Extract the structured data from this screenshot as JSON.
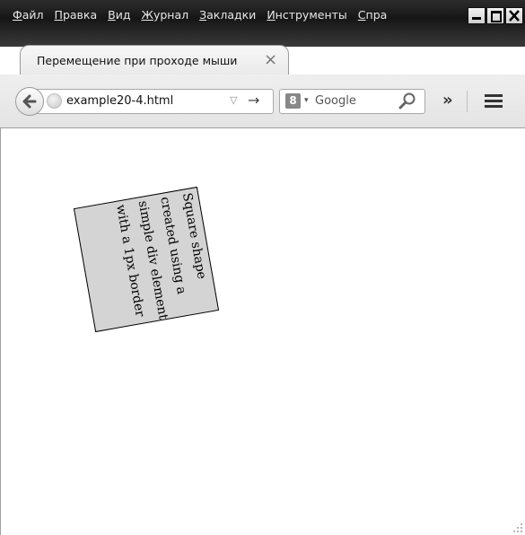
{
  "menubar": {
    "items": [
      {
        "accel": "Ф",
        "rest": "айл"
      },
      {
        "accel": "П",
        "rest": "равка"
      },
      {
        "accel": "В",
        "rest": "ид"
      },
      {
        "accel": "Ж",
        "rest": "урнал"
      },
      {
        "accel": "З",
        "rest": "акладки"
      },
      {
        "accel": "И",
        "rest": "нструменты"
      },
      {
        "accel": "С",
        "rest": "пра"
      }
    ]
  },
  "tab": {
    "title": "Перемещение при проходе мыши",
    "close": "×",
    "new_tab": "+"
  },
  "toolbar": {
    "url": "example20-4.html",
    "url_dropdown": "▽",
    "go": "→",
    "search_engine_letter": "8",
    "search_dropdown": "▾",
    "search_placeholder": "Google",
    "overflow": "»"
  },
  "content": {
    "square_text": "Square shape created using a simple div element with a 1px border"
  },
  "colors": {
    "square_fill": "#d4d4d4",
    "menubar_bg": "#1f1f1f"
  }
}
